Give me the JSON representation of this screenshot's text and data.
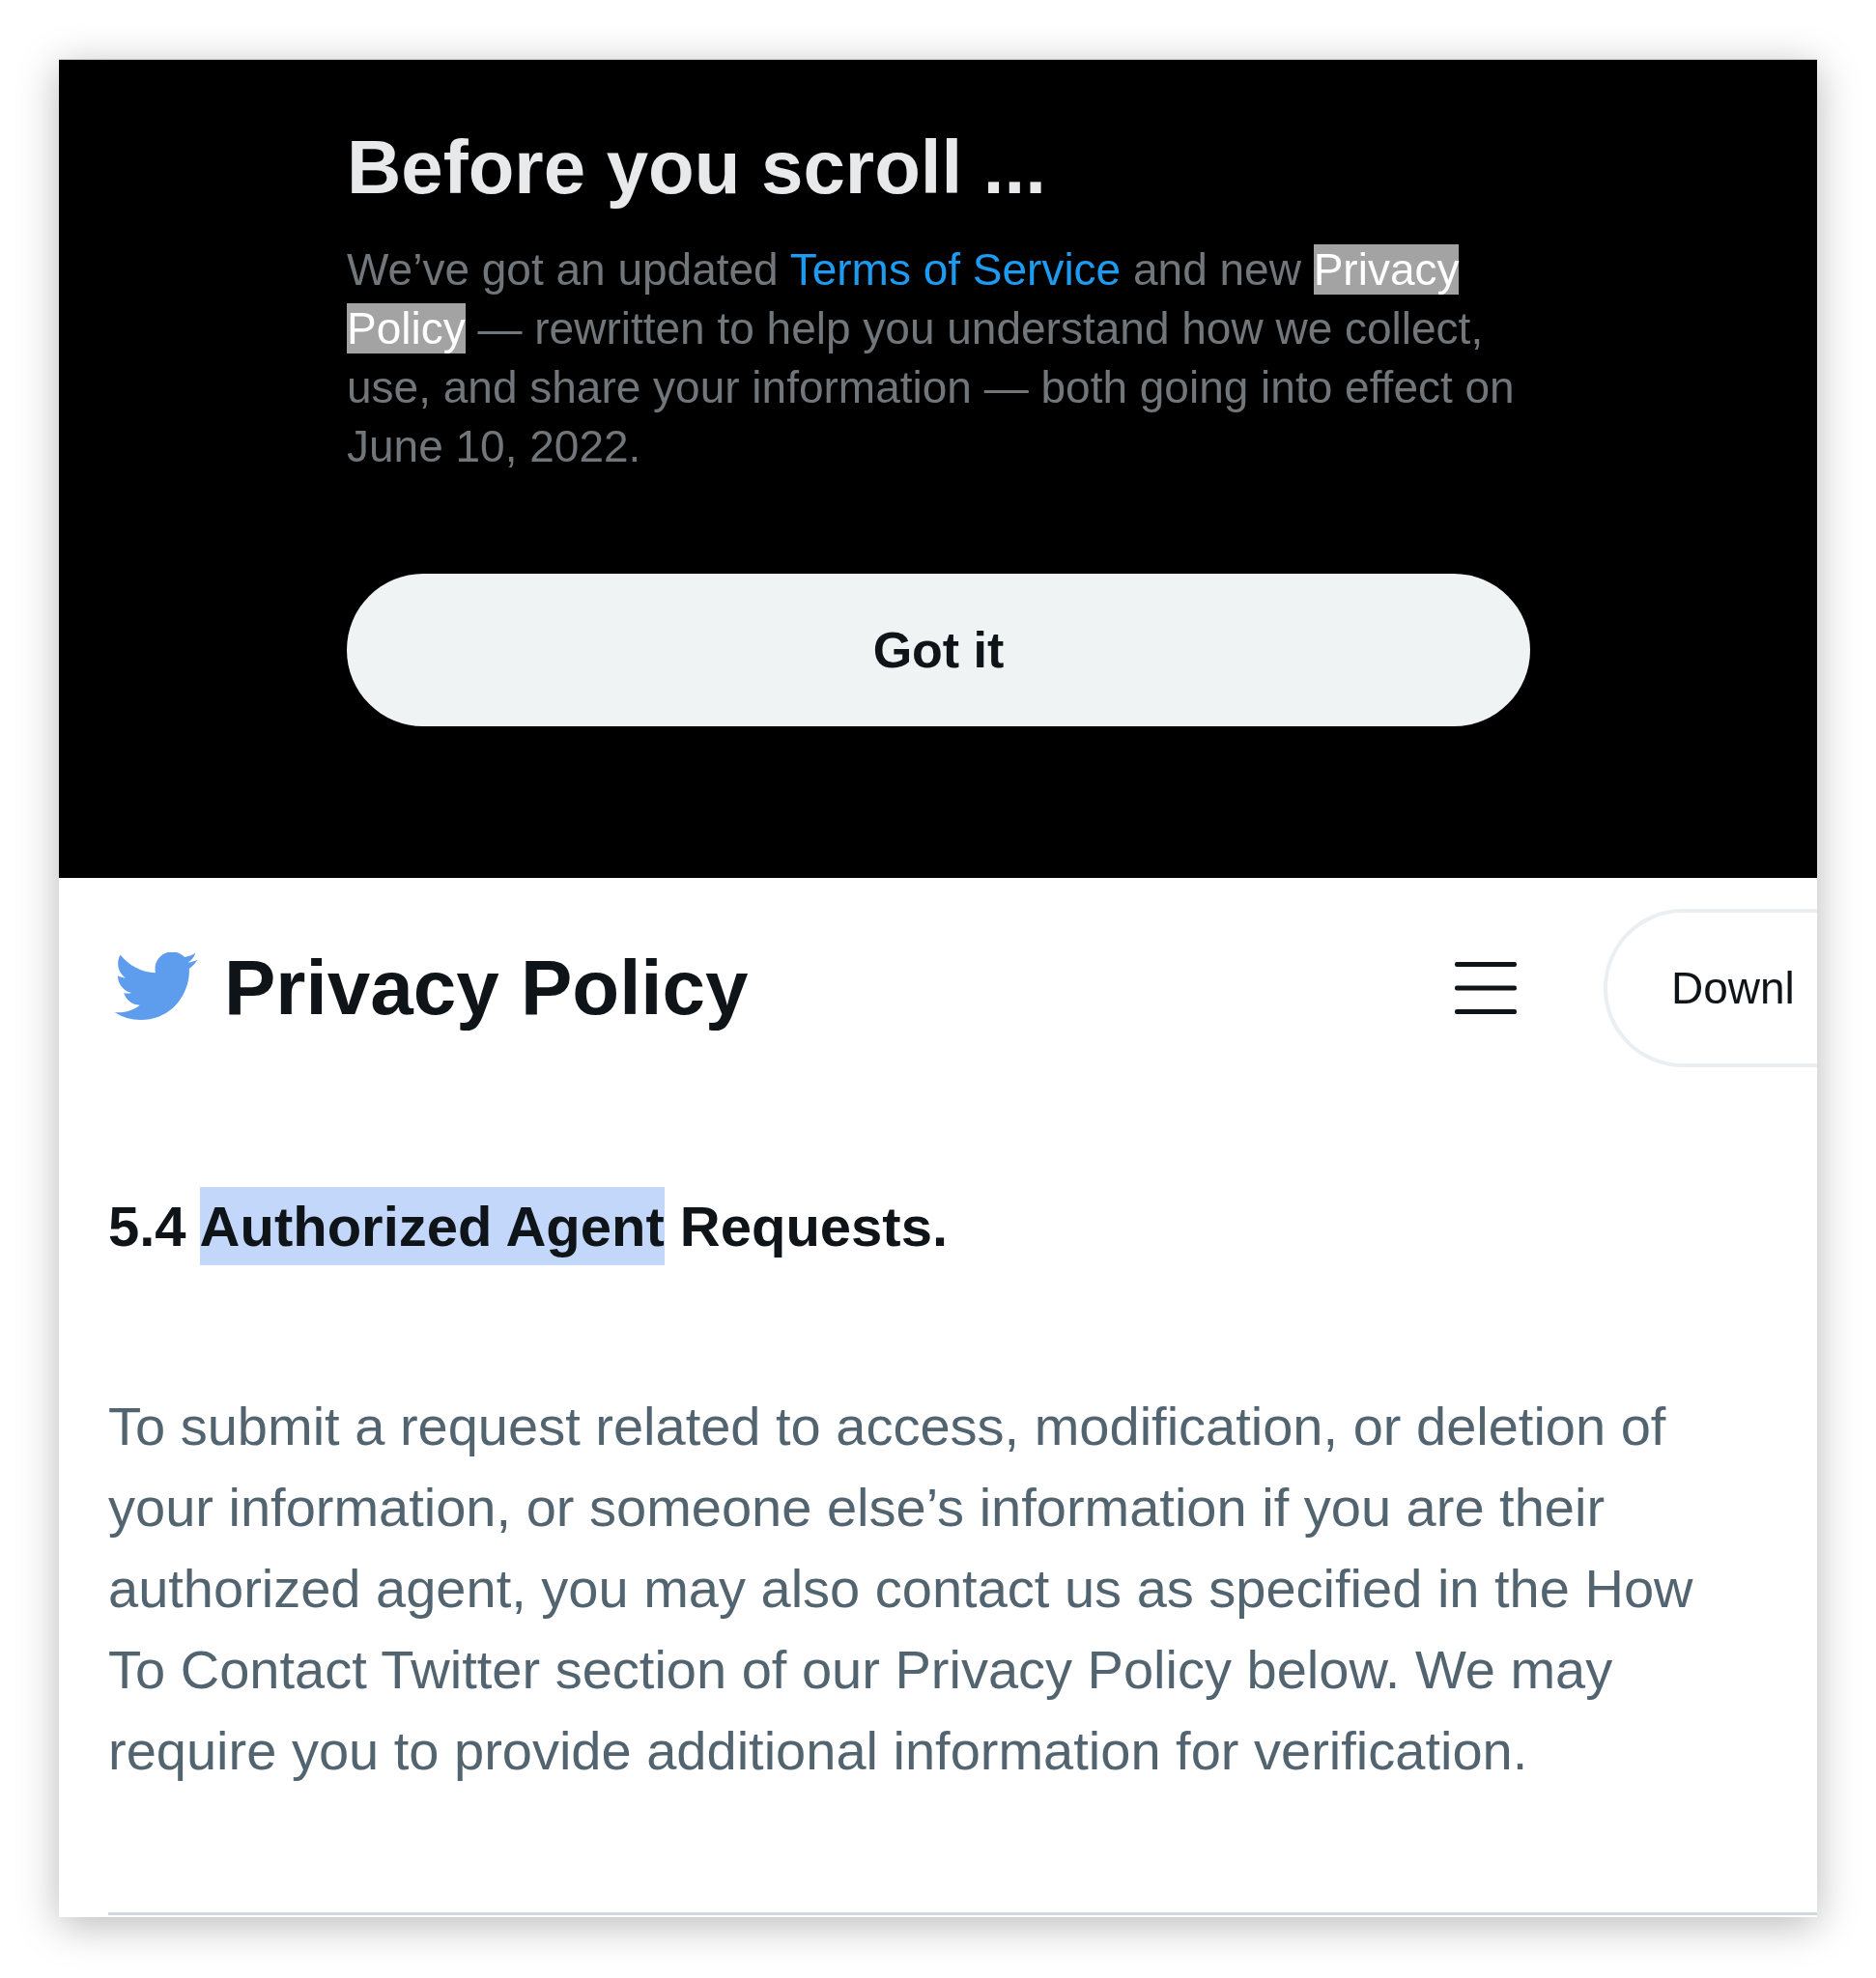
{
  "banner": {
    "title": "Before you scroll ...",
    "text": [
      {
        "kind": "plain",
        "text": "We’ve got an updated ",
        "highlighted": false
      },
      {
        "kind": "link",
        "text": "Terms of Service",
        "highlighted": false
      },
      {
        "kind": "plain",
        "text": " and new ",
        "highlighted": false
      },
      {
        "kind": "plain",
        "text": "Privacy Policy",
        "highlighted": true
      },
      {
        "kind": "plain",
        "text": " — rewritten to help you understand how we collect, use, and share your information — both going into effect on June 10, 2022.",
        "highlighted": false
      }
    ],
    "button": "Got it"
  },
  "header": {
    "title": "Privacy Policy",
    "button": "Downl"
  },
  "section": {
    "heading": [
      {
        "text": "5.4 ",
        "highlighted": false
      },
      {
        "text": "Authorized Agent",
        "highlighted": true
      },
      {
        "text": " Requests.",
        "highlighted": false
      }
    ],
    "text": "To submit a request related to access, modification, or deletion of your information, or someone else’s information if you are their authorized agent, you may also contact us as specified in the How To Contact Twitter section of our Privacy Policy below. We may require you to provide additional information for verification."
  }
}
